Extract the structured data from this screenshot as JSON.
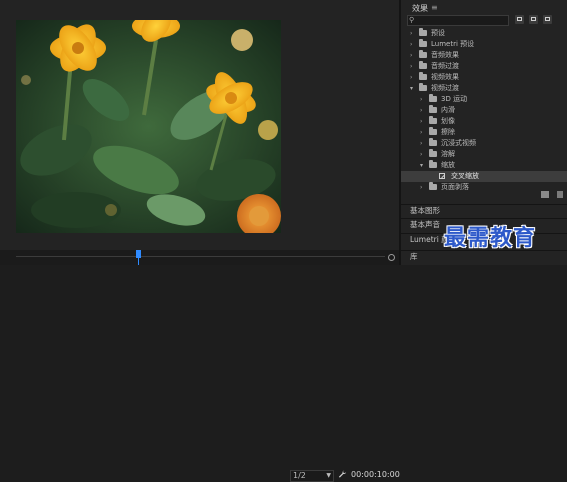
{
  "monitor": {
    "ratio": "1/2",
    "timecode": "00:00:10:00",
    "playhead_progress": 0.33
  },
  "effects_panel": {
    "title": "效果",
    "menu": "≡",
    "search_placeholder": "",
    "tree": [
      {
        "label": "预设",
        "level": 0,
        "expanded": false
      },
      {
        "label": "Lumetri 预设",
        "level": 0,
        "expanded": false
      },
      {
        "label": "音频效果",
        "level": 0,
        "expanded": false
      },
      {
        "label": "音频过渡",
        "level": 0,
        "expanded": false
      },
      {
        "label": "视频效果",
        "level": 0,
        "expanded": false
      },
      {
        "label": "视频过渡",
        "level": 0,
        "expanded": true
      },
      {
        "label": "3D 运动",
        "level": 1,
        "expanded": false
      },
      {
        "label": "内滑",
        "level": 1,
        "expanded": false
      },
      {
        "label": "划像",
        "level": 1,
        "expanded": false
      },
      {
        "label": "擦除",
        "level": 1,
        "expanded": false
      },
      {
        "label": "沉浸式视频",
        "level": 1,
        "expanded": false
      },
      {
        "label": "溶解",
        "level": 1,
        "expanded": false
      },
      {
        "label": "缩放",
        "level": 1,
        "expanded": true
      },
      {
        "label": "交叉缩放",
        "level": 2,
        "effect": true,
        "selected": true
      },
      {
        "label": "页面剥落",
        "level": 1,
        "expanded": false
      }
    ],
    "sections": [
      "基本图形",
      "基本声音",
      "Lumetri 颜色",
      "库"
    ]
  },
  "watermark": "最需教育",
  "colors": {
    "accent": "#2f8bff",
    "panel_bg": "#232323",
    "watermark": "#2d59c9"
  }
}
